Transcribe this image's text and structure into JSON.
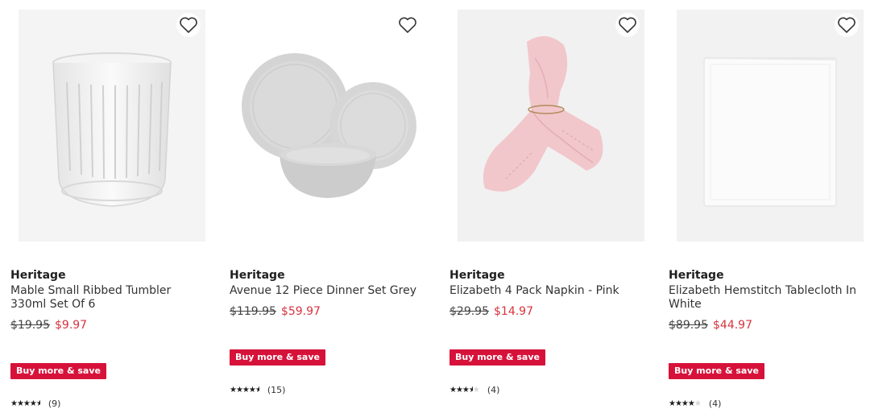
{
  "products": [
    {
      "brand": "Heritage",
      "title": "Mable Small Ribbed Tumbler 330ml Set Of 6",
      "old_price": "$19.95",
      "new_price": "$9.97",
      "badge": "Buy more & save",
      "rating": 4.5,
      "review_count": "(9)"
    },
    {
      "brand": "Heritage",
      "title": "Avenue 12 Piece Dinner Set Grey",
      "old_price": "$119.95",
      "new_price": "$59.97",
      "badge": "Buy more & save",
      "rating": 4.5,
      "review_count": "(15)"
    },
    {
      "brand": "Heritage",
      "title": "Elizabeth 4 Pack Napkin - Pink",
      "old_price": "$29.95",
      "new_price": "$14.97",
      "badge": "Buy more & save",
      "rating": 3.5,
      "review_count": "(4)"
    },
    {
      "brand": "Heritage",
      "title": "Elizabeth Hemstitch Tablecloth In White",
      "old_price": "$89.95",
      "new_price": "$44.97",
      "badge": "Buy more & save",
      "rating": 4,
      "review_count": "(4)"
    }
  ],
  "colors": {
    "badge_bg": "#d7123a",
    "sale_price": "#d6333f"
  },
  "icons": {
    "wishlist": "heart-outline-icon",
    "rating": "star-icon"
  }
}
